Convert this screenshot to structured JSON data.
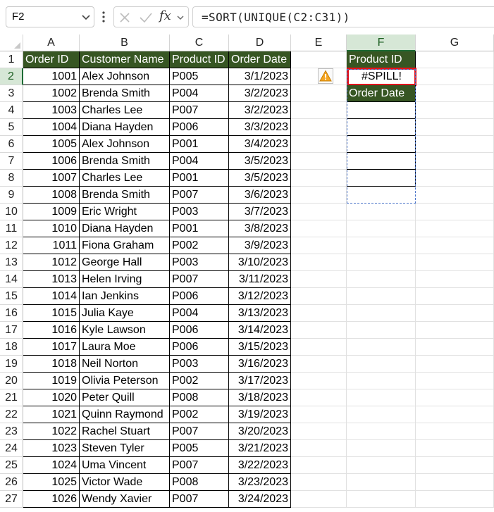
{
  "name_box": {
    "value": "F2"
  },
  "formula": {
    "fx_label": "fx",
    "text": "=SORT(UNIQUE(C2:C31))"
  },
  "columns": [
    "A",
    "B",
    "C",
    "D",
    "E",
    "F",
    "G"
  ],
  "active_column": "F",
  "active_row": "2",
  "rows": [
    "1",
    "2",
    "3",
    "4",
    "5",
    "6",
    "7",
    "8",
    "9",
    "10",
    "11",
    "12",
    "13",
    "14",
    "15",
    "16",
    "17",
    "18",
    "19",
    "20",
    "21",
    "22",
    "23",
    "24",
    "25",
    "26",
    "27"
  ],
  "table": {
    "headers": [
      "Order ID",
      "Customer Name",
      "Product ID",
      "Order Date"
    ],
    "records": [
      [
        "1001",
        "Alex Johnson",
        "P005",
        "3/1/2023"
      ],
      [
        "1002",
        "Brenda Smith",
        "P004",
        "3/2/2023"
      ],
      [
        "1003",
        "Charles Lee",
        "P007",
        "3/2/2023"
      ],
      [
        "1004",
        "Diana Hayden",
        "P006",
        "3/3/2023"
      ],
      [
        "1005",
        "Alex Johnson",
        "P001",
        "3/4/2023"
      ],
      [
        "1006",
        "Brenda Smith",
        "P004",
        "3/5/2023"
      ],
      [
        "1007",
        "Charles Lee",
        "P001",
        "3/5/2023"
      ],
      [
        "1008",
        "Brenda Smith",
        "P007",
        "3/6/2023"
      ],
      [
        "1009",
        "Eric Wright",
        "P003",
        "3/7/2023"
      ],
      [
        "1010",
        "Diana Hayden",
        "P001",
        "3/8/2023"
      ],
      [
        "1011",
        "Fiona Graham",
        "P002",
        "3/9/2023"
      ],
      [
        "1012",
        "George Hall",
        "P003",
        "3/10/2023"
      ],
      [
        "1013",
        "Helen Irving",
        "P007",
        "3/11/2023"
      ],
      [
        "1014",
        "Ian Jenkins",
        "P006",
        "3/12/2023"
      ],
      [
        "1015",
        "Julia Kaye",
        "P004",
        "3/13/2023"
      ],
      [
        "1016",
        "Kyle Lawson",
        "P006",
        "3/14/2023"
      ],
      [
        "1017",
        "Laura Moe",
        "P006",
        "3/15/2023"
      ],
      [
        "1018",
        "Neil Norton",
        "P003",
        "3/16/2023"
      ],
      [
        "1019",
        "Olivia Peterson",
        "P002",
        "3/17/2023"
      ],
      [
        "1020",
        "Peter Quill",
        "P008",
        "3/18/2023"
      ],
      [
        "1021",
        "Quinn Raymond",
        "P002",
        "3/19/2023"
      ],
      [
        "1022",
        "Rachel Stuart",
        "P007",
        "3/20/2023"
      ],
      [
        "1023",
        "Steven Tyler",
        "P005",
        "3/21/2023"
      ],
      [
        "1024",
        "Uma Vincent",
        "P007",
        "3/22/2023"
      ],
      [
        "1025",
        "Victor Wade",
        "P008",
        "3/23/2023"
      ],
      [
        "1026",
        "Wendy Xavier",
        "P007",
        "3/24/2023"
      ]
    ]
  },
  "side_table": {
    "header_product": "Product ID",
    "spill_error": "#SPILL!",
    "header_date": "Order Date"
  },
  "icons": {
    "name_box_dropdown": "chevron-down-icon",
    "more": "vertical-dots-icon",
    "cancel": "x-icon",
    "enter": "check-icon",
    "insert_function": "fx-icon",
    "warning": "warning-triangle-icon"
  },
  "colors": {
    "table_header_bg": "#375623",
    "table_header_text": "#ffffff",
    "spill_error_border": "#e0121c",
    "spill_range_border": "#4a74c9",
    "warning_fill": "#f5a623",
    "active_header_bg": "#d6e7d6"
  }
}
